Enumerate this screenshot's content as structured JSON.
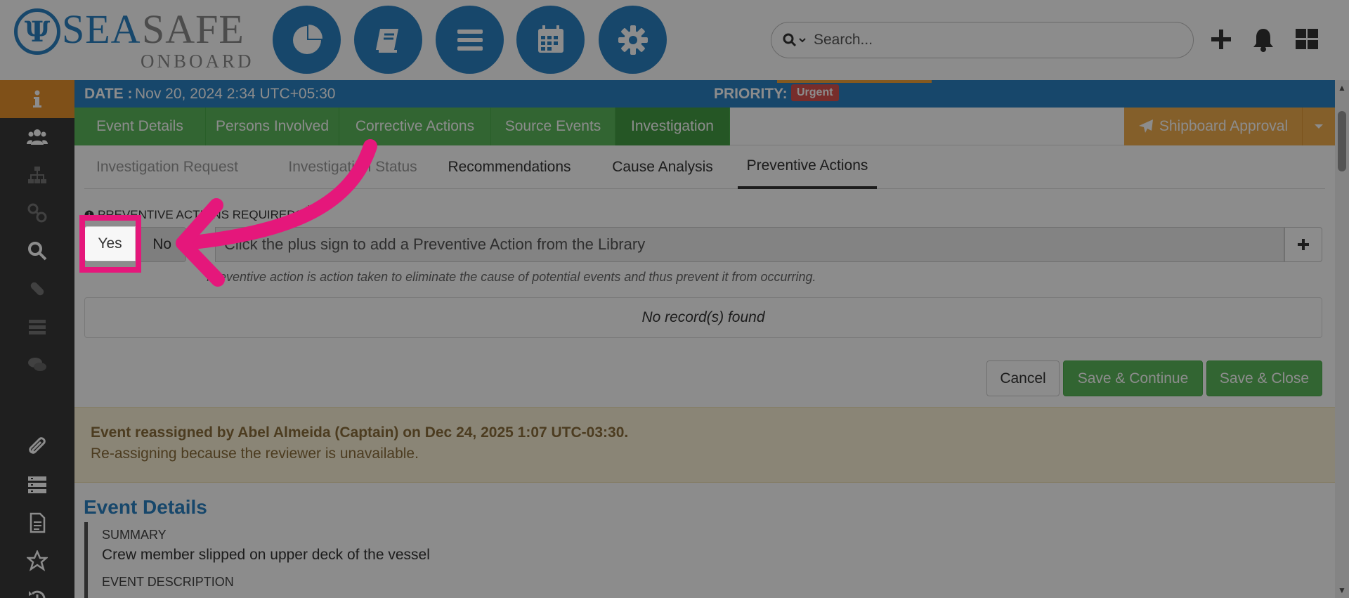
{
  "brand": {
    "name_primary": "SEA",
    "name_secondary": "SAFE",
    "tagline": "ONBOARD",
    "accent_color": "#2a82c4"
  },
  "header": {
    "nav": [
      {
        "name": "pie-chart-icon"
      },
      {
        "name": "book-icon"
      },
      {
        "name": "menu-icon"
      },
      {
        "name": "calendar-icon"
      },
      {
        "name": "gear-icon"
      }
    ],
    "search": {
      "placeholder": "Search..."
    },
    "icons": [
      "plus-icon",
      "bell-icon",
      "grid-icon"
    ]
  },
  "sidebar": {
    "items": [
      {
        "name": "info-icon",
        "active": true
      },
      {
        "name": "users-icon"
      },
      {
        "name": "hierarchy-icon"
      },
      {
        "name": "link-icon"
      },
      {
        "name": "search-icon"
      },
      {
        "name": "pill-icon"
      },
      {
        "name": "list-icon"
      },
      {
        "name": "comments-icon"
      },
      {
        "name": "paperclip-icon"
      },
      {
        "name": "table-icon"
      },
      {
        "name": "document-icon"
      },
      {
        "name": "star-icon"
      },
      {
        "name": "history-icon"
      }
    ]
  },
  "event": {
    "date_label": "DATE :",
    "date_value": "Nov 20, 2024 2:34 UTC+05:30",
    "priority_label": "PRIORITY:",
    "priority_value": "Urgent"
  },
  "tabs": [
    "Event Details",
    "Persons Involved",
    "Corrective Actions",
    "Source Events",
    "Investigation"
  ],
  "approval": {
    "label": "Shipboard Approval"
  },
  "subtabs": [
    "Investigation Request",
    "Investigation Status",
    "Recommendations",
    "Cause Analysis",
    "Preventive Actions"
  ],
  "preventive": {
    "label": "PREVENTIVE ACTIONS REQUIRED?",
    "required_mark": "*",
    "yes": "Yes",
    "no": "No",
    "library_prompt": "Click the plus sign to add a Preventive Action from the Library",
    "helper": "Preventive action is action taken to eliminate the cause of potential events and thus prevent it from occurring.",
    "empty": "No record(s) found"
  },
  "buttons": {
    "cancel": "Cancel",
    "save_continue": "Save & Continue",
    "save_close": "Save & Close"
  },
  "alert": {
    "title": "Event reassigned by Abel Almeida (Captain) on Dec 24, 2025 1:07 UTC-03:30.",
    "body": "Re-assigning because the reviewer is unavailable."
  },
  "details": {
    "section_title": "Event Details",
    "summary_label": "SUMMARY",
    "summary_value": "Crew member slipped on upper deck of the vessel",
    "description_label": "EVENT DESCRIPTION"
  },
  "colors": {
    "blue": "#2a82c4",
    "green": "#5cb85c",
    "orange": "#f0ad4e",
    "highlight": "#e5177b"
  }
}
